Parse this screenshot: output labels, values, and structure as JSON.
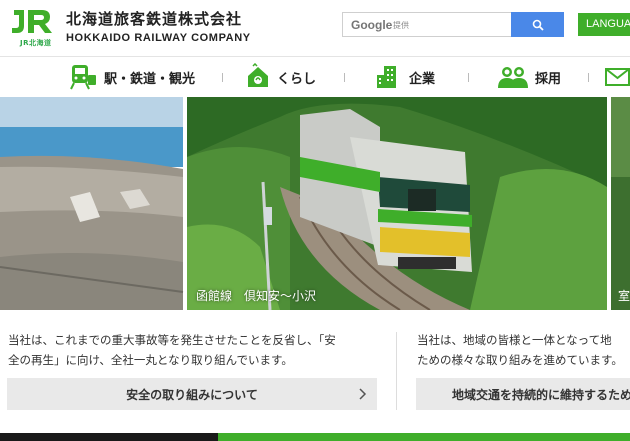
{
  "header": {
    "logo_text": "JR北海道",
    "company_name_ja": "北海道旅客鉄道株式会社",
    "company_name_en": "HOKKAIDO RAILWAY COMPANY",
    "search": {
      "brand": "Google",
      "provided": "提供",
      "button_icon": "search-icon"
    },
    "language_label": "LANGUAGE"
  },
  "nav": {
    "items": [
      {
        "label": "駅・鉄道・観光",
        "icon": "train-icon"
      },
      {
        "label": "くらし",
        "icon": "home-icon"
      },
      {
        "label": "企業",
        "icon": "building-icon"
      },
      {
        "label": "採用",
        "icon": "people-icon"
      },
      {
        "label": "",
        "icon": "mail-icon"
      }
    ]
  },
  "hero": {
    "caption": "函館線　倶知安～小沢",
    "caption_right": "室"
  },
  "cards": [
    {
      "text_line1": "当社は、これまでの重大事故等を発生させたことを反省し、「安",
      "text_line2": "全の再生」に向け、全社一丸となり取り組んでいます。",
      "button_label": "安全の取り組みについて"
    },
    {
      "text_line1": "当社は、地域の皆様と一体となって地",
      "text_line2": "ための様々な取り組みを進めています。",
      "button_label": "地域交通を持続的に維持するため"
    }
  ],
  "colors": {
    "brand_green": "#3fae2a",
    "search_blue": "#4a88e8"
  }
}
